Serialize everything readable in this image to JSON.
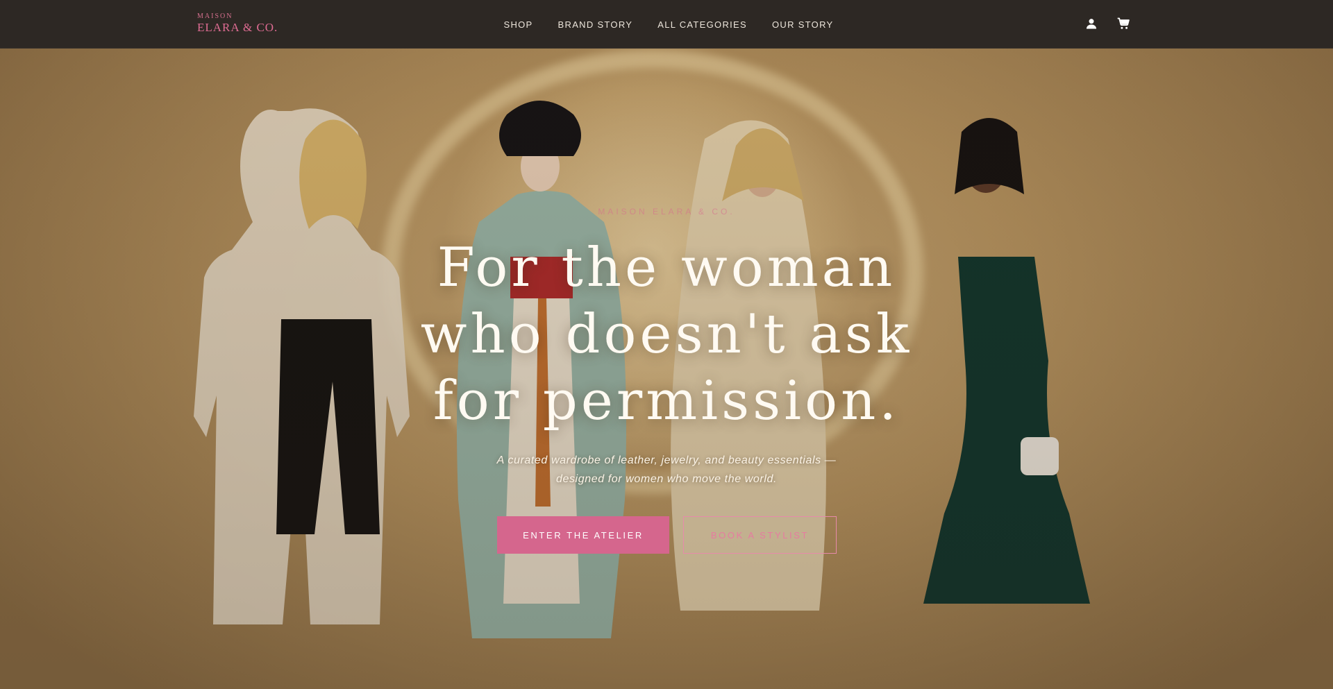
{
  "brand": {
    "small": "MAISON",
    "main": "ELARA & CO.",
    "accent_color": "#d5668d"
  },
  "nav": {
    "links": [
      "SHOP",
      "BRAND STORY",
      "ALL CATEGORIES",
      "OUR STORY"
    ],
    "icons": [
      "account-icon",
      "cart-icon"
    ]
  },
  "hero": {
    "eyebrow": "MAISON ELARA & CO.",
    "headline": [
      "For the woman",
      "who doesn't ask",
      "for permission."
    ],
    "subtext": [
      "A curated wardrobe of leather, jewelry, and beauty essentials —",
      "designed for women who move the world."
    ],
    "primary_cta": "ENTER THE ATELIER",
    "secondary_cta": "BOOK A STYLIST"
  }
}
